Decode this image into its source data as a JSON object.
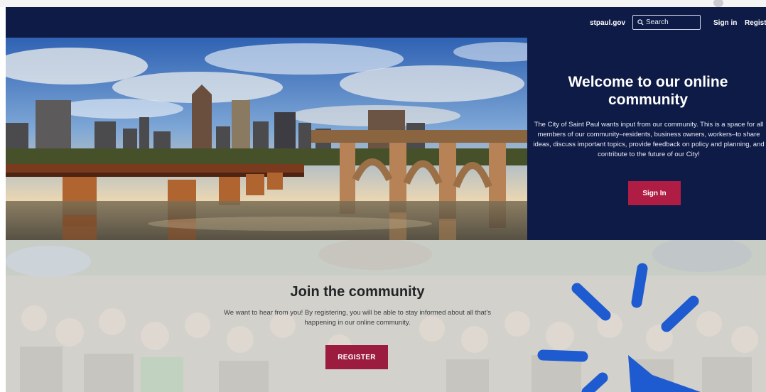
{
  "header": {
    "site_link": "stpaul.gov",
    "search_placeholder": "Search",
    "sign_in": "Sign in",
    "register": "Register"
  },
  "hero": {
    "welcome_title": "Welcome to our online community",
    "welcome_text": "The City of Saint Paul wants input from our community. This is a space for all members of our community–residents, business owners, workers–to share ideas, discuss important topics, provide feedback on policy and planning, and contribute to the future of our City!",
    "sign_in_button": "Sign In"
  },
  "join": {
    "title": "Join the community",
    "description": "We want to hear from you! By registering, you will be able to stay informed about all that's happening in our online community.",
    "register_button": "REGISTER"
  },
  "icons": {
    "search": "search-icon",
    "loading": "loading-spinner-icon"
  },
  "colors": {
    "navy": "#0e1b46",
    "button_red": "#b01d44",
    "register_red": "#9c1c3f",
    "spinner_blue": "#1f5bd0"
  }
}
